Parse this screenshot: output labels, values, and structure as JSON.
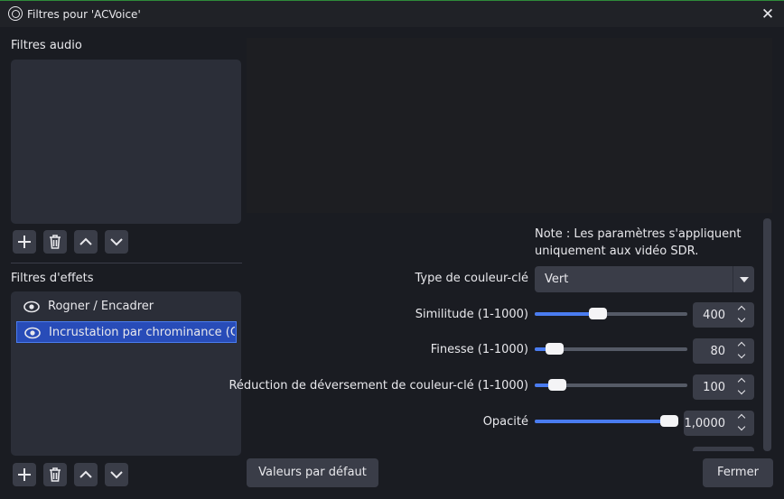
{
  "window": {
    "title": "Filtres pour 'ACVoice'"
  },
  "audio_filters": {
    "label": "Filtres audio",
    "items": []
  },
  "effect_filters": {
    "label": "Filtres d'effets",
    "items": [
      {
        "name": "Rogner / Encadrer",
        "selected": false
      },
      {
        "name": "Incrustation par chrominance (Chi",
        "selected": true
      }
    ]
  },
  "properties": {
    "note": "Note : Les paramètres s'appliquent uniquement aux vidéo SDR.",
    "key_color_type": {
      "label": "Type de couleur-clé",
      "value": "Vert"
    },
    "similarity": {
      "label": "Similitude (1-1000)",
      "value": "400",
      "fraction": 0.4
    },
    "smoothness": {
      "label": "Finesse (1-1000)",
      "value": "80",
      "fraction": 0.08
    },
    "spill_reduction": {
      "label": "Réduction de déversement de couleur-clé (1-1000)",
      "value": "100",
      "fraction": 0.1
    },
    "opacity": {
      "label": "Opacité",
      "value": "1,0000",
      "fraction": 1.0
    }
  },
  "buttons": {
    "defaults": "Valeurs par défaut",
    "close": "Fermer"
  },
  "colors": {
    "accent": "#4a7cf0",
    "selection": "#284cb8",
    "background": "#1a1c22",
    "panel": "#2b2e38"
  }
}
